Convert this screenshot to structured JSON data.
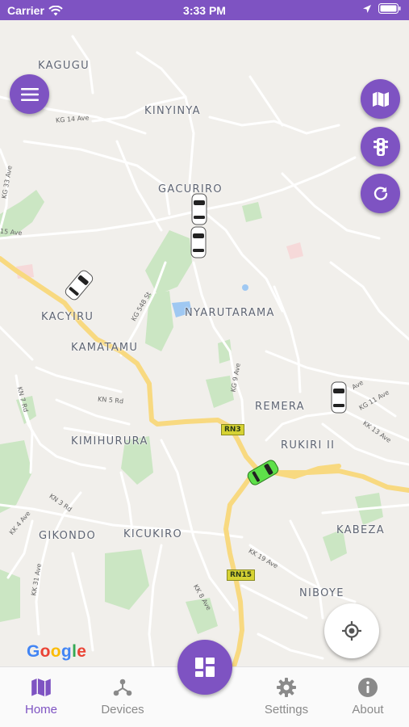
{
  "status_bar": {
    "carrier": "Carrier",
    "time": "3:33 PM"
  },
  "map": {
    "places": [
      "KAGUGU",
      "KINYINYA",
      "GACURIRO",
      "NYARUTARAMA",
      "KACYIRU",
      "KAMATAMU",
      "REMERA",
      "RUKIRI II",
      "KIMIHURURA",
      "GIKONDO",
      "KICUKIRO",
      "KABEZA",
      "NIBOYE"
    ],
    "road_labels": [
      "KG 14 Ave",
      "KG 33 Ave",
      "15 Ave",
      "KG 548 St",
      "KG 9 Ave",
      "KN 5 Rd",
      "KN 7 Rd",
      "KG 11 Ave",
      "KK 13 Ave",
      "KN 3 Rd",
      "KK 4 Ave",
      "KK 31 Ave",
      "KK 19 Ave",
      "KK 8 Ave",
      "Ave"
    ],
    "route_shields": [
      "RN3",
      "RN15"
    ],
    "attribution": "Google"
  },
  "buttons": {
    "menu_icon": "menu-icon",
    "map_type_icon": "map-icon",
    "traffic_icon": "traffic-light-icon",
    "refresh_icon": "refresh-icon",
    "locate_icon": "my-location-icon",
    "dashboard_icon": "dashboard-icon"
  },
  "tabs": [
    {
      "label": "Home",
      "icon": "map-icon",
      "active": true
    },
    {
      "label": "Devices",
      "icon": "devices-icon",
      "active": false
    },
    {
      "label": "Settings",
      "icon": "gear-icon",
      "active": false
    },
    {
      "label": "About",
      "icon": "info-icon",
      "active": false
    }
  ],
  "colors": {
    "primary": "#7e53c2",
    "tab_inactive": "#8a8a8a",
    "active_vehicle": "#5ee04a",
    "vehicle": "#ffffff"
  }
}
